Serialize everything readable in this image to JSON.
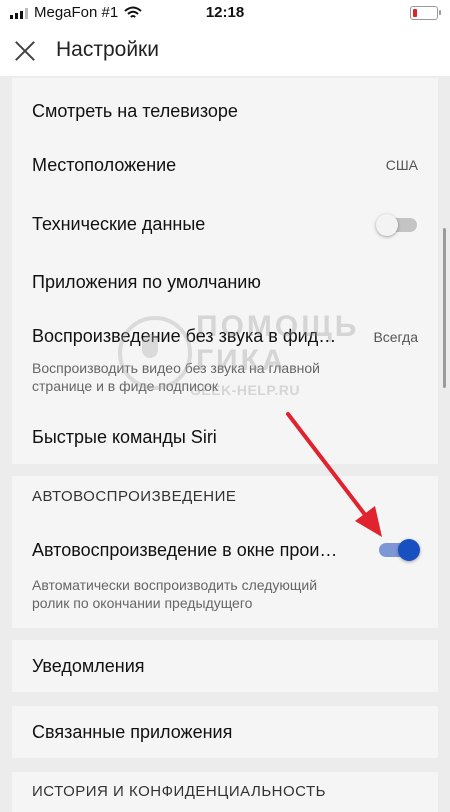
{
  "status": {
    "carrier": "MegaFon #1",
    "time": "12:18"
  },
  "header": {
    "title": "Настройки"
  },
  "general": {
    "tv": "Смотреть на телевизоре",
    "location": {
      "label": "Местоположение",
      "value": "США"
    },
    "tech": {
      "label": "Технические данные",
      "toggle_on": false
    },
    "apps": "Приложения по умолчанию",
    "muted": {
      "label": "Воспроизведение без звука в фид…",
      "value": "Всегда",
      "sub1": "Воспроизводить видео без звука на главной",
      "sub2": "странице и в фиде подписок"
    },
    "siri": "Быстрые команды Siri"
  },
  "autoplay": {
    "header": "АВТОВОСПРОИЗВЕДЕНИЕ",
    "label": "Автовоспроизведение в окне прои…",
    "toggle_on": true,
    "sub1": "Автоматически воспроизводить следующий",
    "sub2": "ролик по окончании предыдущего"
  },
  "notifications": "Уведомления",
  "connected": "Связанные приложения",
  "history_header": "ИСТОРИЯ И КОНФИДЕНЦИАЛЬНОСТЬ",
  "watermark": {
    "line1": "ПОМОЩЬ",
    "line2": "ГИКА",
    "url": "GEEK-HELP.RU"
  },
  "colors": {
    "accent": "#1850c2",
    "arrow": "#e0232e"
  }
}
